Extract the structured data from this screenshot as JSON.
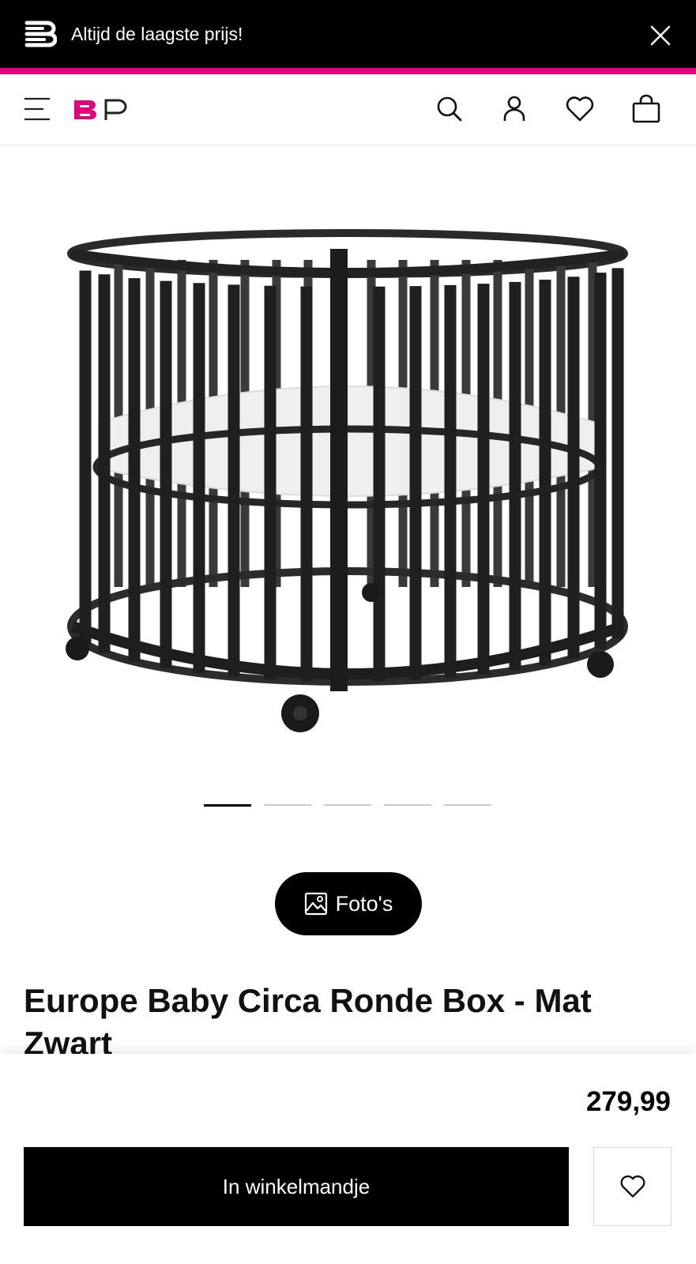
{
  "promo": {
    "text": "Altijd de laagste prijs!",
    "icon": "brand-logo-icon",
    "close_icon": "close-icon"
  },
  "header": {
    "menu_icon": "hamburger-icon",
    "logo_icon": "bp-logo",
    "icons": [
      "search-icon",
      "account-icon",
      "heart-icon",
      "shopping-bag-icon"
    ]
  },
  "gallery": {
    "image": "round-crib-product-image",
    "slides": 5,
    "active_slide": 1,
    "photos_label": "Foto's"
  },
  "product": {
    "title": "Europe Baby Circa Ronde Box - Mat Zwart",
    "price": "279,99"
  },
  "actions": {
    "add_to_cart_label": "In winkelmandje",
    "wishlist_icon": "heart-icon"
  },
  "colors": {
    "accent": "#e5007e",
    "banner": "#000000",
    "button": "#000000"
  }
}
